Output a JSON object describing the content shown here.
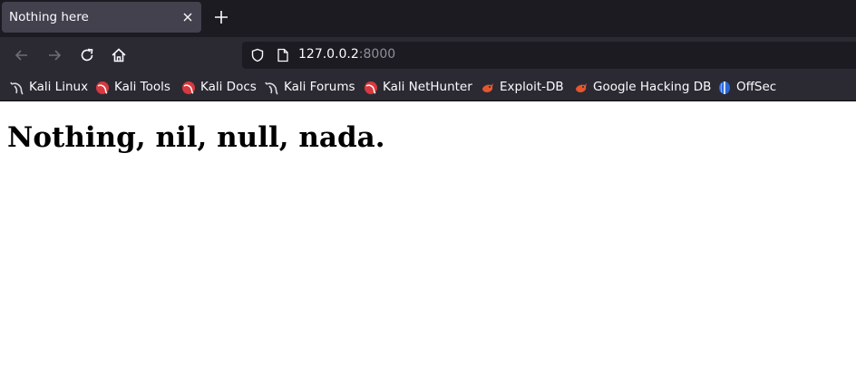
{
  "browser": {
    "tab": {
      "title": "Nothing here"
    },
    "address_bar": {
      "host": "127.0.0.2",
      "port": ":8000"
    },
    "bookmarks": [
      {
        "label": "Kali Linux",
        "icon": "kali-dragon-icon"
      },
      {
        "label": "Kali Tools",
        "icon": "kali-red-icon"
      },
      {
        "label": "Kali Docs",
        "icon": "kali-red-icon"
      },
      {
        "label": "Kali Forums",
        "icon": "kali-dragon-icon"
      },
      {
        "label": "Kali NetHunter",
        "icon": "kali-red-icon"
      },
      {
        "label": "Exploit-DB",
        "icon": "exploit-db-icon"
      },
      {
        "label": "Google Hacking DB",
        "icon": "exploit-db-icon"
      },
      {
        "label": "OffSec",
        "icon": "offsec-icon"
      }
    ]
  },
  "page": {
    "heading": "Nothing, nil, null, nada."
  },
  "colors": {
    "tabstrip": "#1c1b22",
    "toolbar": "#2b2a33",
    "active_tab": "#42414d",
    "text": "#fbfbfe",
    "port": "#8f8f9d"
  }
}
